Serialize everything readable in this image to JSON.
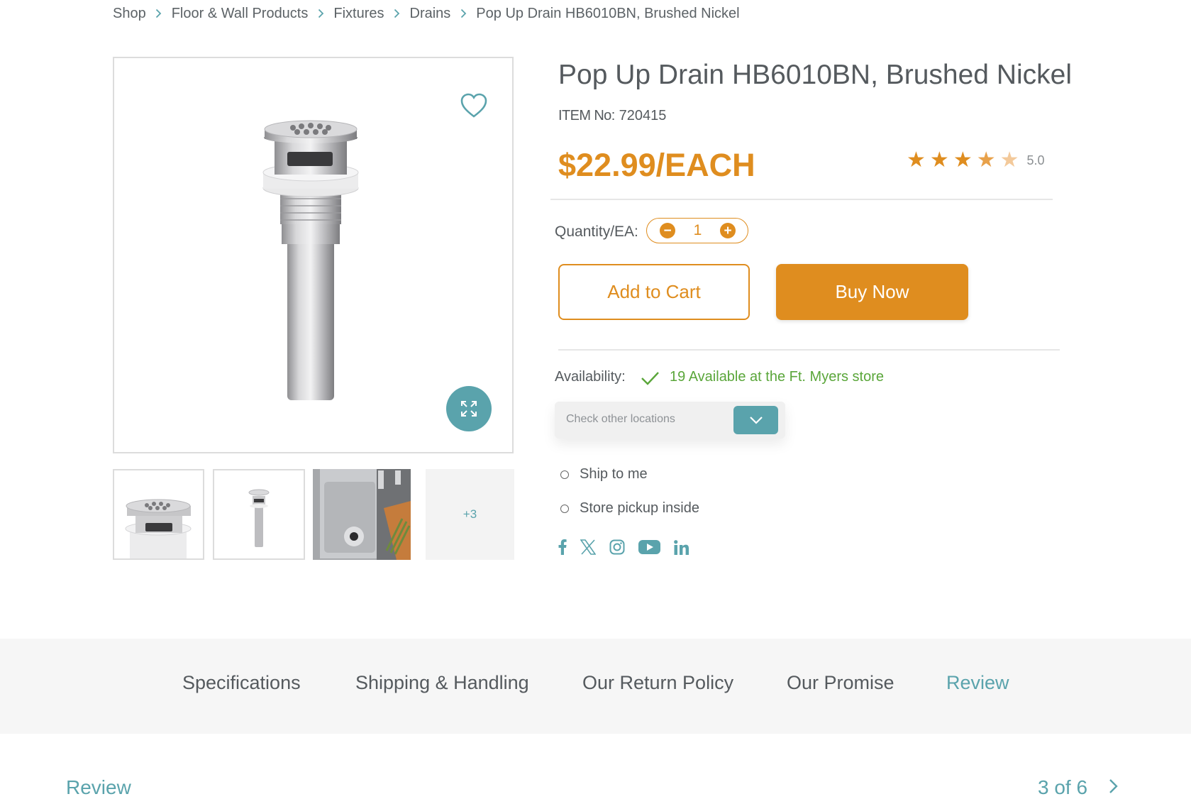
{
  "breadcrumb": [
    "Shop",
    "Floor & Wall Products",
    "Fixtures",
    "Drains",
    "Pop Up Drain HB6010BN, Brushed Nickel"
  ],
  "product": {
    "title": "Pop Up Drain HB6010BN, Brushed Nickel",
    "item_label": "ITEM No:",
    "item_number": "720415",
    "price": "$22.99/EACH",
    "rating": "5.0",
    "stars_filled": 4.5,
    "stars_total": 5
  },
  "gallery": {
    "more_label": "+3",
    "thumbnail_count_shown": 4
  },
  "quantity": {
    "label": "Quantity/EA:",
    "value": "1"
  },
  "actions": {
    "add_to_cart": "Add to Cart",
    "buy_now": "Buy Now"
  },
  "availability": {
    "label": "Availability:",
    "status": "19 Available at the Ft. Myers store",
    "locations_placeholder": "Check other locations"
  },
  "fulfillment": {
    "options": [
      "Ship to me",
      "Store pickup inside"
    ]
  },
  "social": [
    "facebook-icon",
    "x-icon",
    "instagram-icon",
    "youtube-icon",
    "linkedin-icon"
  ],
  "tabs": [
    "Specifications",
    "Shipping & Handling",
    "Our Return Policy",
    "Our Promise",
    "Review"
  ],
  "active_tab": "Review",
  "review": {
    "heading": "Review",
    "pager": "3 of 6"
  },
  "colors": {
    "accent_orange": "#df8d1f",
    "accent_teal": "#5aa3ac",
    "available_green": "#5aa63a",
    "star_empty": "#f3c99a"
  }
}
